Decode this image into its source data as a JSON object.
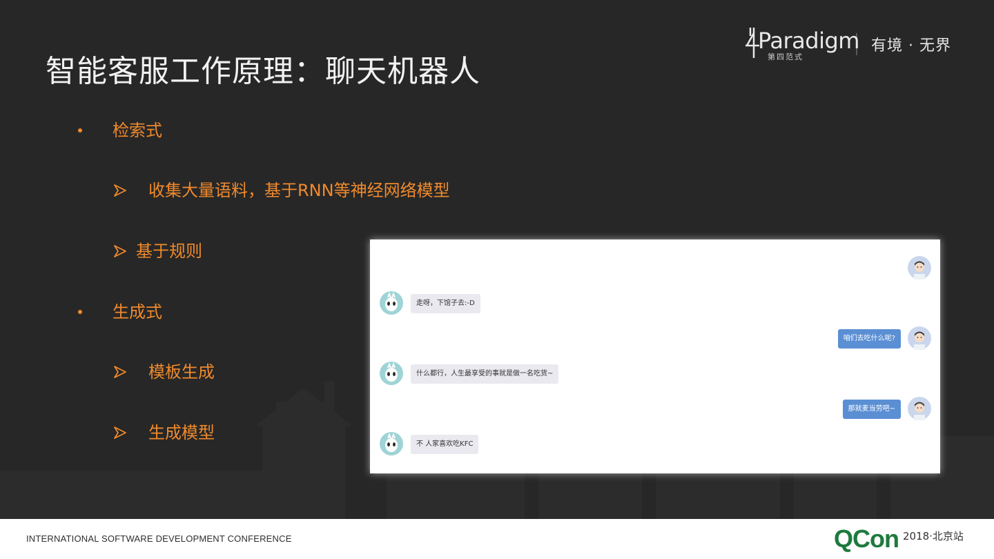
{
  "slide": {
    "title": "智能客服工作原理：聊天机器人",
    "brand": {
      "logo_text": "4Paradigm",
      "logo_subtext": "第四范式",
      "slogan": "有境 · 无界"
    },
    "bullets": [
      {
        "level": 1,
        "text": "检索式"
      },
      {
        "level": 2,
        "text": "收集大量语料，基于RNN等神经网络模型"
      },
      {
        "level": 2,
        "text": "基于规则"
      },
      {
        "level": 1,
        "text": "生成式"
      },
      {
        "level": 2,
        "text": "模板生成"
      },
      {
        "level": 2,
        "text": "生成模型"
      }
    ],
    "chat": {
      "messages": [
        {
          "from": "user",
          "text": ""
        },
        {
          "from": "bot",
          "text": "走呀，下馆子去:-D"
        },
        {
          "from": "user",
          "text": "咱们去吃什么呢?"
        },
        {
          "from": "bot",
          "text": "什么都行，人生最享受的事就是做一名吃货~"
        },
        {
          "from": "user",
          "text": "那就麦当劳吧~"
        },
        {
          "from": "bot",
          "text": "不 人家喜欢吃KFC"
        }
      ]
    },
    "colors": {
      "background": "#272727",
      "accent": "#f08a2c",
      "title": "#f2f2f2",
      "user_bubble": "#5b8fd4",
      "bot_bubble": "#e9e9ef"
    }
  },
  "footer": {
    "conference": "INTERNATIONAL SOFTWARE DEVELOPMENT CONFERENCE",
    "event_logo": "QCon",
    "edition": "2018·北京站",
    "logo_color": "#1d7a3d"
  }
}
